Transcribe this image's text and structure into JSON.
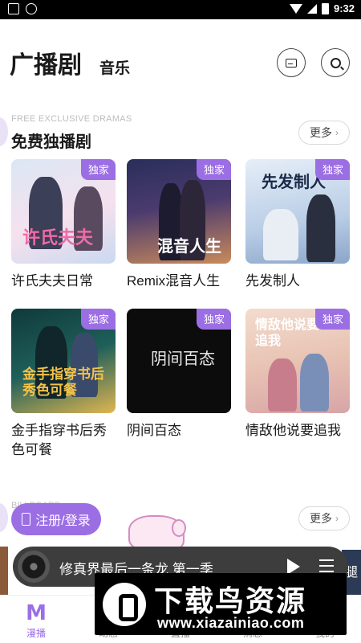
{
  "status_bar": {
    "time": "9:32"
  },
  "header": {
    "title": "广播剧",
    "tab_music": "音乐"
  },
  "section_free": {
    "en_label": "FREE EXCLUSIVE DRAMAS",
    "title": "免费独播剧",
    "more_label": "更多",
    "items": [
      {
        "title": "许氏夫夫日常",
        "badge": "独家",
        "cover_text": "许氏夫夫"
      },
      {
        "title": "Remix混音人生",
        "badge": "独家",
        "cover_text": "混音人生"
      },
      {
        "title": "先发制人",
        "badge": "独家",
        "cover_text": "先发制人"
      },
      {
        "title": "金手指穿书后秀色可餐",
        "badge": "独家",
        "cover_text": "金手指穿书后 秀色可餐"
      },
      {
        "title": "阴间百态",
        "badge": "独家",
        "cover_text": "阴间百态"
      },
      {
        "title": "情敌他说要追我",
        "badge": "独家",
        "cover_text": "情敌他说要追我"
      }
    ]
  },
  "section_second": {
    "en_label_partial": "BILLBOARD",
    "more_label": "更多"
  },
  "login_button": {
    "label": "注册/登录"
  },
  "player": {
    "title": "修真界最后一条龙 第一季"
  },
  "right_strip_text": "腿",
  "tabbar": {
    "tabs": [
      {
        "label": "漫播",
        "active": true
      },
      {
        "label": "动态"
      },
      {
        "label": "直播"
      },
      {
        "label": "消息"
      },
      {
        "label": "我的"
      }
    ]
  },
  "watermark": {
    "title": "下载鸟资源",
    "url": "www.xiazainiao.com"
  },
  "colors": {
    "accent": "#9b6ee4",
    "player_bg": "#3d3d3d"
  }
}
